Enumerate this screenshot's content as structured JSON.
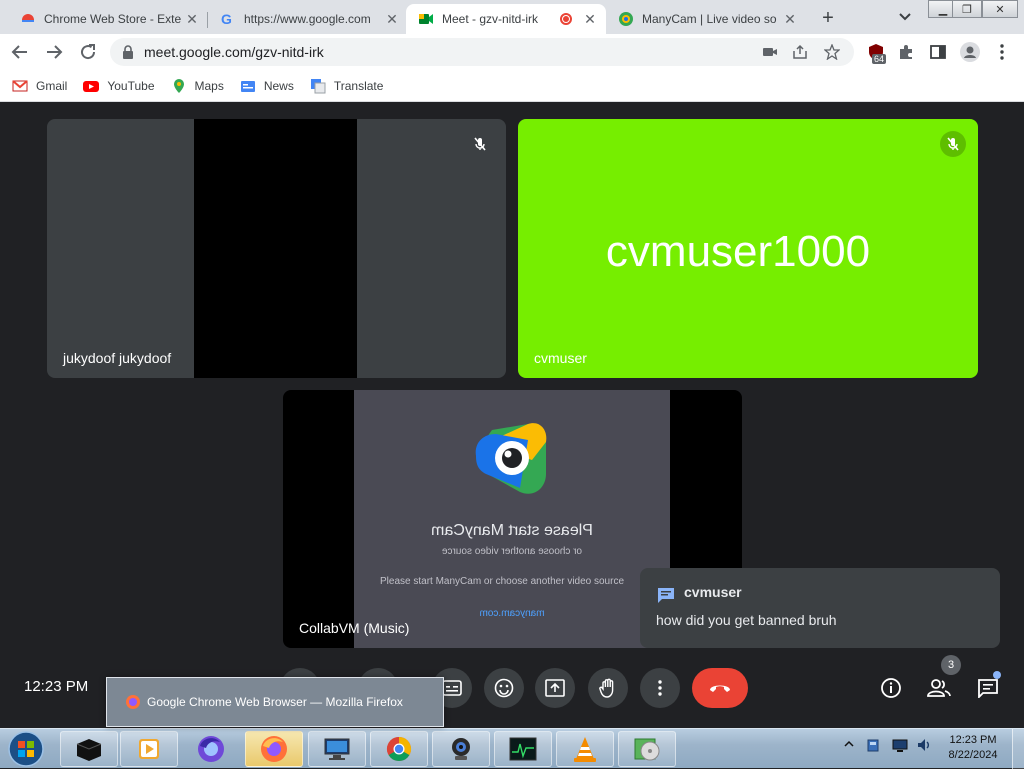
{
  "browser": {
    "tabs": [
      {
        "title": "Chrome Web Store - Exte",
        "icon": "chrome-web-store-icon",
        "active": false
      },
      {
        "title": "https://www.google.com",
        "icon": "google-icon",
        "active": false
      },
      {
        "title": "Meet - gzv-nitd-irk",
        "icon": "google-meet-icon",
        "active": true
      },
      {
        "title": "ManyCam | Live video so",
        "icon": "manycam-icon",
        "active": false
      }
    ],
    "new_tab_label": "+",
    "url": "meet.google.com/gzv-nitd-irk",
    "extension_badge": "64",
    "bookmarks": [
      {
        "label": "Gmail",
        "icon": "gmail-icon"
      },
      {
        "label": "YouTube",
        "icon": "youtube-icon"
      },
      {
        "label": "Maps",
        "icon": "maps-icon"
      },
      {
        "label": "News",
        "icon": "news-icon"
      },
      {
        "label": "Translate",
        "icon": "translate-icon"
      }
    ]
  },
  "meet": {
    "tiles": [
      {
        "name": "jukydoof jukydoof"
      },
      {
        "name": "cvmuser",
        "placeholder_text": "cvmuser1000",
        "bg_color": "#76ee00"
      },
      {
        "name": "CollabVM (Music)"
      }
    ],
    "manycam": {
      "mirrored_title": "Please start ManyCam",
      "mirrored_sub": "or choose another video source",
      "notice": "Please start ManyCam or choose another video source",
      "link": "manycam.com"
    },
    "chat_popup": {
      "sender": "cvmuser",
      "message": "how did you get banned bruh"
    },
    "time": "12:23 PM",
    "participants_count": "3",
    "colors": {
      "end_call": "#ea4335",
      "bar": "#3c4043"
    }
  },
  "tooltip": {
    "text": "Google Chrome Web Browser — Mozilla Firefox"
  },
  "taskbar": {
    "clock_time": "12:23 PM",
    "clock_date": "8/22/2024"
  }
}
